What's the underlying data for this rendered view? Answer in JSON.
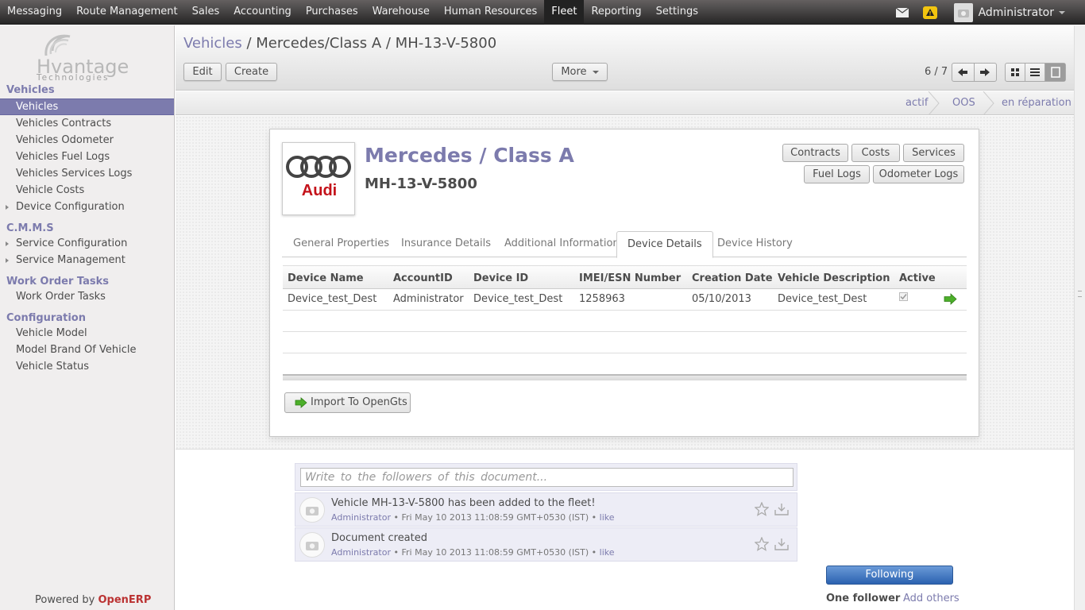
{
  "topmenu": {
    "items": [
      "Messaging",
      "Route Management",
      "Sales",
      "Accounting",
      "Purchases",
      "Warehouse",
      "Human Resources",
      "Fleet",
      "Reporting",
      "Settings"
    ],
    "active": "Fleet",
    "user": "Administrator"
  },
  "sidebar": {
    "logo_text": "Hvantage",
    "logo_sub": "Technologies",
    "sections": [
      {
        "title": "Vehicles",
        "items": [
          {
            "label": "Vehicles",
            "active": true
          },
          {
            "label": "Vehicles Contracts"
          },
          {
            "label": "Vehicles Odometer"
          },
          {
            "label": "Vehicles Fuel Logs"
          },
          {
            "label": "Vehicles Services Logs"
          },
          {
            "label": "Vehicle Costs"
          },
          {
            "label": "Device Configuration",
            "expandable": true
          }
        ]
      },
      {
        "title": "C.M.M.S",
        "items": [
          {
            "label": "Service Configuration",
            "expandable": true
          },
          {
            "label": "Service Management",
            "expandable": true
          }
        ]
      },
      {
        "title": "Work Order Tasks",
        "items": [
          {
            "label": "Work Order Tasks"
          }
        ]
      },
      {
        "title": "Configuration",
        "items": [
          {
            "label": "Vehicle Model"
          },
          {
            "label": "Model Brand Of Vehicle"
          },
          {
            "label": "Vehicle Status"
          }
        ]
      }
    ],
    "powered_by": "Powered by",
    "powered_brand": "OpenERP"
  },
  "header": {
    "breadcrumb_link": "Vehicles",
    "breadcrumb_sep": " / ",
    "breadcrumb_current": "Mercedes/Class A / MH-13-V-5800",
    "edit_label": "Edit",
    "create_label": "Create",
    "more_label": "More",
    "pager": "6 / 7"
  },
  "status_stages": [
    "actif",
    "OOS",
    "en réparation"
  ],
  "form": {
    "title": "Mercedes / Class A",
    "plate": "MH-13-V-5800",
    "brand_logo_text": "Audi",
    "smart_buttons": [
      "Contracts",
      "Costs",
      "Services",
      "Fuel Logs",
      "Odometer Logs"
    ],
    "tabs": [
      "General Properties",
      "Insurance Details",
      "Additional Information",
      "Device Details",
      "Device History"
    ],
    "active_tab": "Device Details",
    "grid": {
      "columns": [
        "Device Name",
        "AccountID",
        "Device ID",
        "IMEI/ESN Number",
        "Creation Date",
        "Vehicle Description",
        "Active"
      ],
      "rows": [
        [
          "Device_test_Dest",
          "Administrator",
          "Device_test_Dest",
          "1258963",
          "05/10/2013",
          "Device_test_Dest",
          true
        ]
      ]
    },
    "import_button": "Import To OpenGts"
  },
  "chatter": {
    "placeholder": "Write to the followers of this document...",
    "messages": [
      {
        "body": "Vehicle MH-13-V-5800 has been added to the fleet!",
        "author": "Administrator",
        "date": "Fri May 10 2013 11:08:59 GMT+0530 (IST)",
        "like": "like"
      },
      {
        "body": "Document created",
        "author": "Administrator",
        "date": "Fri May 10 2013 11:08:59 GMT+0530 (IST)",
        "like": "like"
      }
    ],
    "following_label": "Following",
    "followers_label": "One follower",
    "add_others_label": "Add others"
  },
  "colors": {
    "accent": "#7c7bad",
    "follow": "#2b62b0"
  }
}
